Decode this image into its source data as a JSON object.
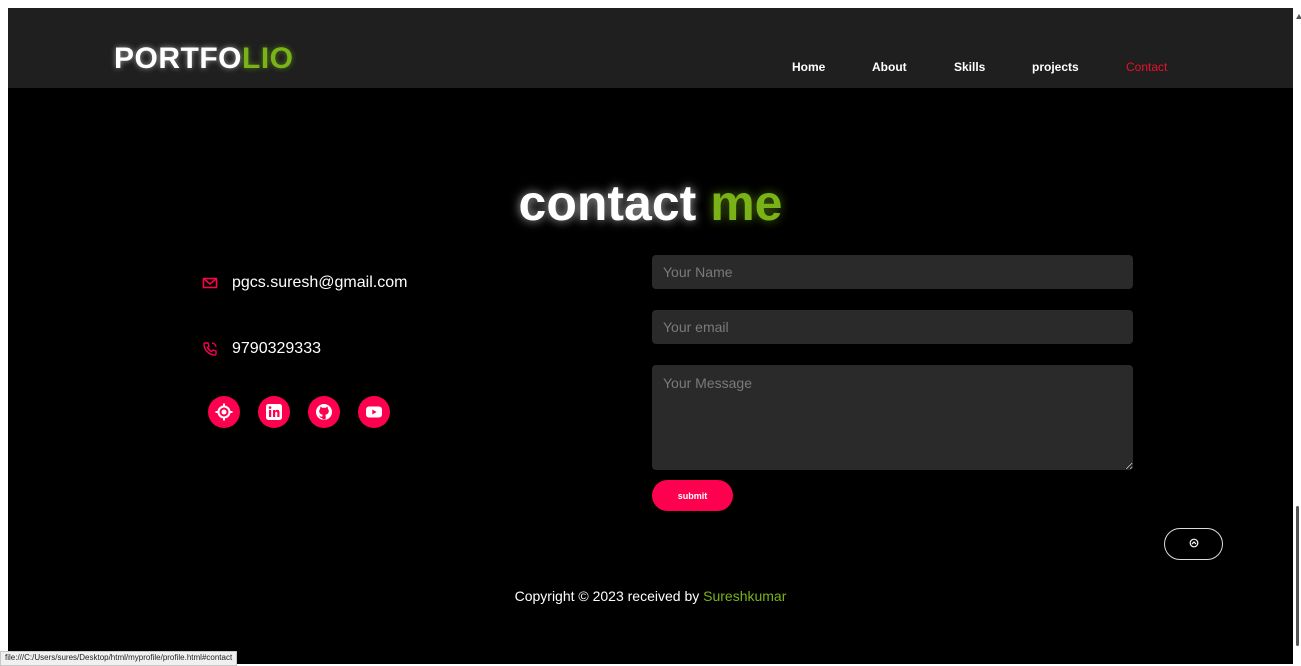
{
  "header": {
    "logo_main": "PORTFO",
    "logo_accent": "LIO",
    "nav": [
      "Home",
      "About",
      "Skills",
      "projects",
      "Contact"
    ]
  },
  "contact": {
    "title_main": "contact ",
    "title_accent": "me",
    "email": "pgcs.suresh@gmail.com",
    "phone": "9790329333",
    "socials": [
      "location-icon",
      "linkedin-icon",
      "github-icon",
      "youtube-icon"
    ]
  },
  "form": {
    "name_placeholder": "Your Name",
    "email_placeholder": "Your email",
    "message_placeholder": "Your Message",
    "submit_label": "submit"
  },
  "footer": {
    "copyright_text": "Copyright © 2023 received by ",
    "author": "Sureshkumar"
  },
  "status_url": "file:///C:/Users/sures/Desktop/html/myprofile/profile.html#contact",
  "colors": {
    "accent_green": "#7ab317",
    "accent_pink": "#ff004f",
    "active_nav": "#e8122c",
    "background": "#000000",
    "navbar": "#1f1f1f"
  }
}
